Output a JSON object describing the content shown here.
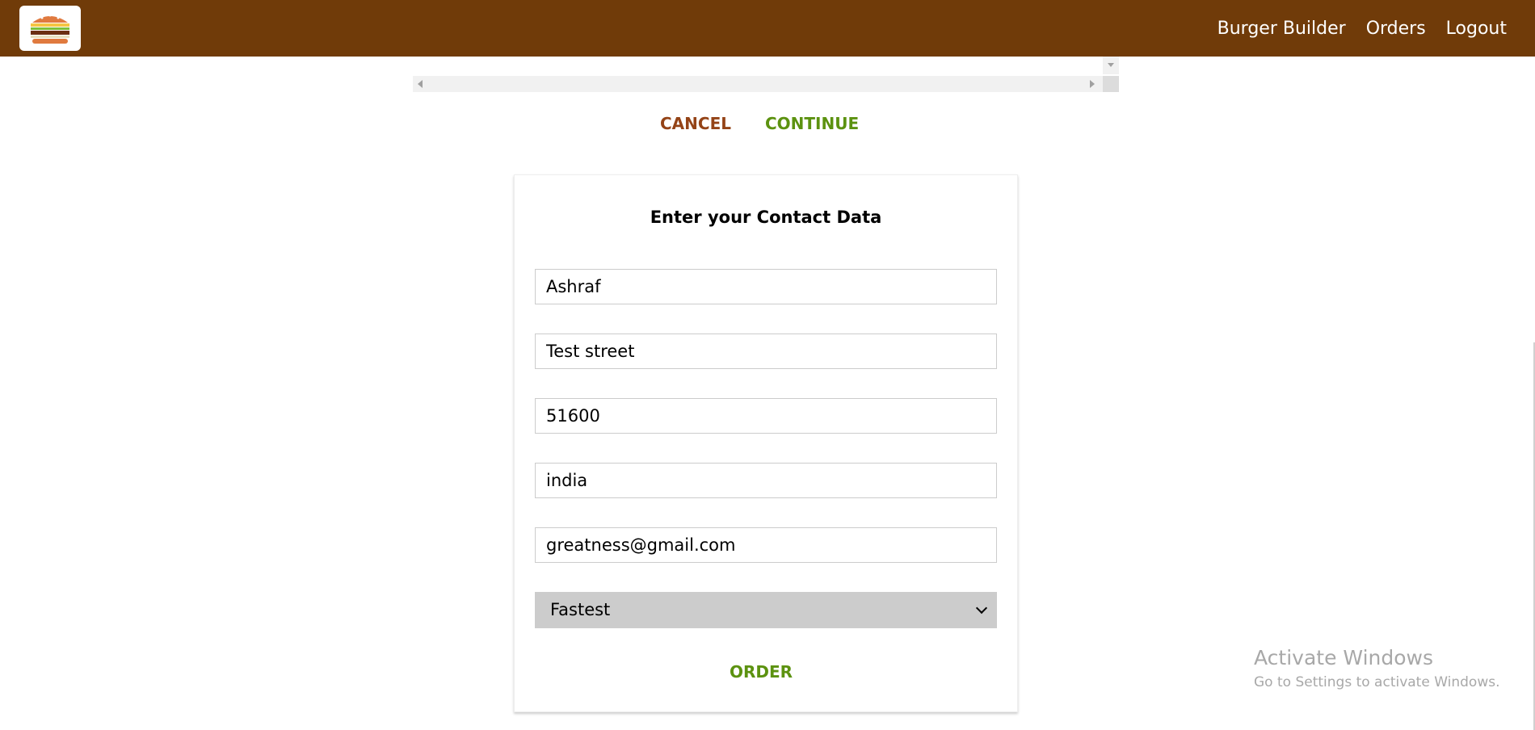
{
  "toolbar": {
    "logo_icon": "burger-logo-icon",
    "nav": {
      "burger_builder": "Burger Builder",
      "orders": "Orders",
      "logout": "Logout"
    }
  },
  "summary_actions": {
    "cancel": "CANCEL",
    "continue": "CONTINUE"
  },
  "contact_form": {
    "title": "Enter your Contact Data",
    "name": "Ashraf",
    "street": "Test street",
    "postal_code": "51600",
    "country": "india",
    "email": "greatness@gmail.com",
    "delivery_method": "Fastest",
    "order_button": "ORDER"
  },
  "watermark": {
    "line1": "Activate Windows",
    "line2": "Go to Settings to activate Windows."
  },
  "colors": {
    "toolbar": "#703B09",
    "danger": "#944317",
    "success": "#5C9210"
  }
}
